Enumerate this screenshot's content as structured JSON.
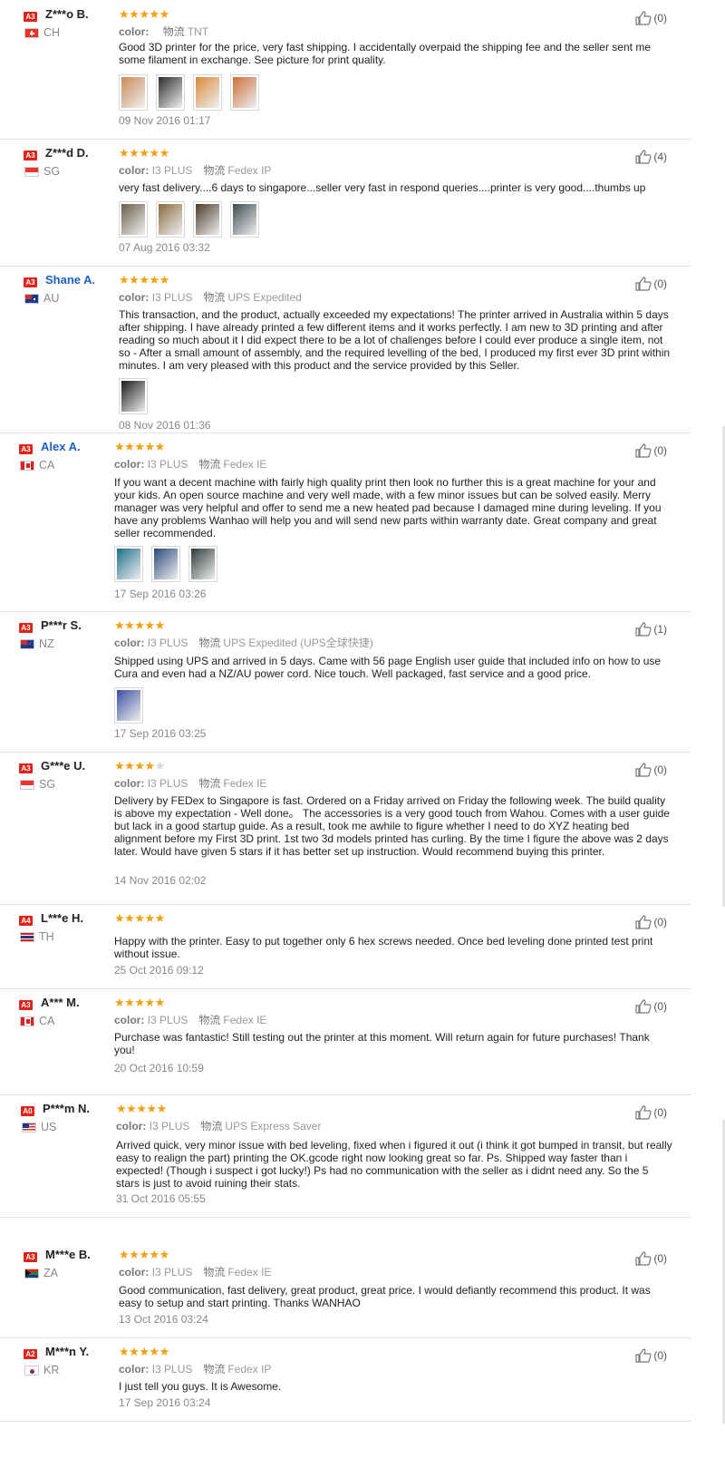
{
  "reviews": [
    {
      "level": "A3",
      "name": "Z***o B.",
      "country": "CH",
      "flag": "ch",
      "stars": 5,
      "color_label": "color:",
      "color": "",
      "logistics_label": "物流",
      "logistics": "TNT",
      "color_line_mode": "logi-only",
      "text": "Good 3D printer for the price, very fast shipping. I accidentally overpaid the shipping fee and the seller sent me some filament in exchange. See picture for print quality.",
      "photos": [
        "#c98a55",
        "#2b2b2b",
        "#d88a3b",
        "#c8703a"
      ],
      "date": "09 Nov 2016 01:17",
      "likes": "(0)",
      "name_link": false
    },
    {
      "level": "A3",
      "name": "Z***d D.",
      "country": "SG",
      "flag": "sg",
      "stars": 5,
      "color_label": "color:",
      "color": "I3 PLUS",
      "logistics_label": "物流",
      "logistics": "Fedex IP",
      "text": "very fast delivery....6 days to singapore...seller very fast in respond queries....printer is very good....thumbs up",
      "photos": [
        "#6b5d4b",
        "#8a6a3e",
        "#4a3a2a",
        "#3c4a50"
      ],
      "date": "07 Aug 2016 03:32",
      "likes": "(4)",
      "name_link": false
    },
    {
      "level": "A3",
      "name": "Shane A.",
      "country": "AU",
      "flag": "au",
      "stars": 5,
      "color_label": "color:",
      "color": "I3 PLUS",
      "logistics_label": "物流",
      "logistics": "UPS Expedited",
      "text": "This transaction, and the product, actually exceeded my expectations! The printer arrived in Australia within 5 days after shipping. I have already printed a few different items and it works perfectly. I am new to 3D printing and after reading so much about it I did expect there to be a lot of challenges before I could ever produce a single item, not so - After a small amount of assembly, and the required levelling of the bed, I produced my first ever 3D print within minutes. I am very pleased with this product and the service provided by this Seller.",
      "photos": [
        "#1a1a1a"
      ],
      "date": "08 Nov 2016 01:36",
      "likes": "(0)",
      "name_link": true
    },
    {
      "level": "A3",
      "name": "Alex A.",
      "country": "CA",
      "flag": "ca",
      "stars": 5,
      "color_label": "color:",
      "color": "I3 PLUS",
      "logistics_label": "物流",
      "logistics": "Fedex IE",
      "text": "If you want a decent machine with fairly high quality print then look no further this is a great machine for your and your kids. An open source machine and very well made, with a few minor issues but can be solved easily. Merry manager was very helpful and offer to send me a new heated pad because I damaged mine during leveling. If you have any problems Wanhao will help you and will send new parts within warranty date. Great company and great seller recommended.",
      "photos": [
        "#1f6f8b",
        "#2a4a7a",
        "#2f3a3a"
      ],
      "date": "17 Sep 2016 03:26",
      "likes": "(0)",
      "name_link": true
    },
    {
      "level": "A3",
      "name": "P***r S.",
      "country": "NZ",
      "flag": "nz",
      "stars": 5,
      "color_label": "color:",
      "color": "I3 PLUS",
      "logistics_label": "物流",
      "logistics": "UPS Expedited (UPS全球快捷)",
      "text": "Shipped using UPS and arrived in 5 days. Came with 56 page English user guide that included info on how to use Cura and even had a NZ/AU power cord. Nice touch. Well packaged, fast service and a good price.",
      "photos": [
        "#3a4fa0"
      ],
      "date": "17 Sep 2016 03:25",
      "likes": "(1)",
      "name_link": false
    },
    {
      "level": "A3",
      "name": "G***e U.",
      "country": "SG",
      "flag": "sg",
      "stars": 4,
      "color_label": "color:",
      "color": "I3 PLUS",
      "logistics_label": "物流",
      "logistics": "Fedex IE",
      "text": "Delivery by FEDex to Singapore is fast. Ordered on a Friday arrived on Friday the following week. The build quality is above my expectation - Well done。 The accessories is a very good touch from Wahou. Comes with a user guide but lack in a good startup guide. As a result, took me awhile to figure whether I need to do XYZ heating bed alignment before my First 3D print. 1st two 3d models printed has curling. By the time I figure the above was 2 days later. Would have given 5 stars if it has better set up instruction. Would recommend buying this printer.",
      "photos": [],
      "date": "14 Nov 2016 02:02",
      "likes": "(0)",
      "name_link": false
    },
    {
      "level": "A4",
      "name": "L***e H.",
      "country": "TH",
      "flag": "th",
      "stars": 5,
      "color_label": "",
      "color": "",
      "logistics_label": "",
      "logistics": "",
      "text": "Happy with the printer. Easy to put together only 6 hex screws needed. Once bed leveling done printed test print without issue.",
      "photos": [],
      "date": "25 Oct 2016 09:12",
      "likes": "(0)",
      "name_link": false
    },
    {
      "level": "A3",
      "name": "A*** M.",
      "country": "CA",
      "flag": "ca",
      "stars": 5,
      "color_label": "color:",
      "color": "I3 PLUS",
      "logistics_label": "物流",
      "logistics": "Fedex IE",
      "text": "Purchase was fantastic! Still testing out the printer at this moment. Will return again for future purchases! Thank you!",
      "photos": [],
      "date": "20 Oct 2016 10:59",
      "likes": "(0)",
      "name_link": false
    },
    {
      "level": "A0",
      "name": "P***m N.",
      "country": "US",
      "flag": "us",
      "stars": 5,
      "color_label": "color:",
      "color": "I3 PLUS",
      "logistics_label": "物流",
      "logistics": "UPS Express Saver",
      "text": "Arrived quick, very minor issue with bed leveling, fixed when i figured it out (i think it got bumped in transit, but really easy to realign the part) printing the OK.gcode right now looking great so far. Ps. Shipped way faster than i expected! (Though i suspect i got lucky!) Ps had no communication with the seller as i didnt need any. So the 5 stars is just to avoid ruining their stats.",
      "photos": [],
      "date": "31 Oct 2016 05:55",
      "likes": "(0)",
      "name_link": false
    },
    {
      "level": "A3",
      "name": "M***e B.",
      "country": "ZA",
      "flag": "za",
      "stars": 5,
      "color_label": "color:",
      "color": "I3 PLUS",
      "logistics_label": "物流",
      "logistics": "Fedex IE",
      "text": "Good communication, fast delivery, great product, great price. I would defiantly recommend this product. It was easy to setup and start printing. Thanks WANHAO",
      "photos": [],
      "date": "13 Oct 2016 03:24",
      "likes": "(0)",
      "name_link": false
    },
    {
      "level": "A2",
      "name": "M***n Y.",
      "country": "KR",
      "flag": "kr",
      "stars": 5,
      "color_label": "color:",
      "color": "I3 PLUS",
      "logistics_label": "物流",
      "logistics": "Fedex IP",
      "text": "I just tell you guys. It is Awesome.",
      "photos": [],
      "date": "17 Sep 2016 03:24",
      "likes": "(0)",
      "name_link": false
    }
  ]
}
